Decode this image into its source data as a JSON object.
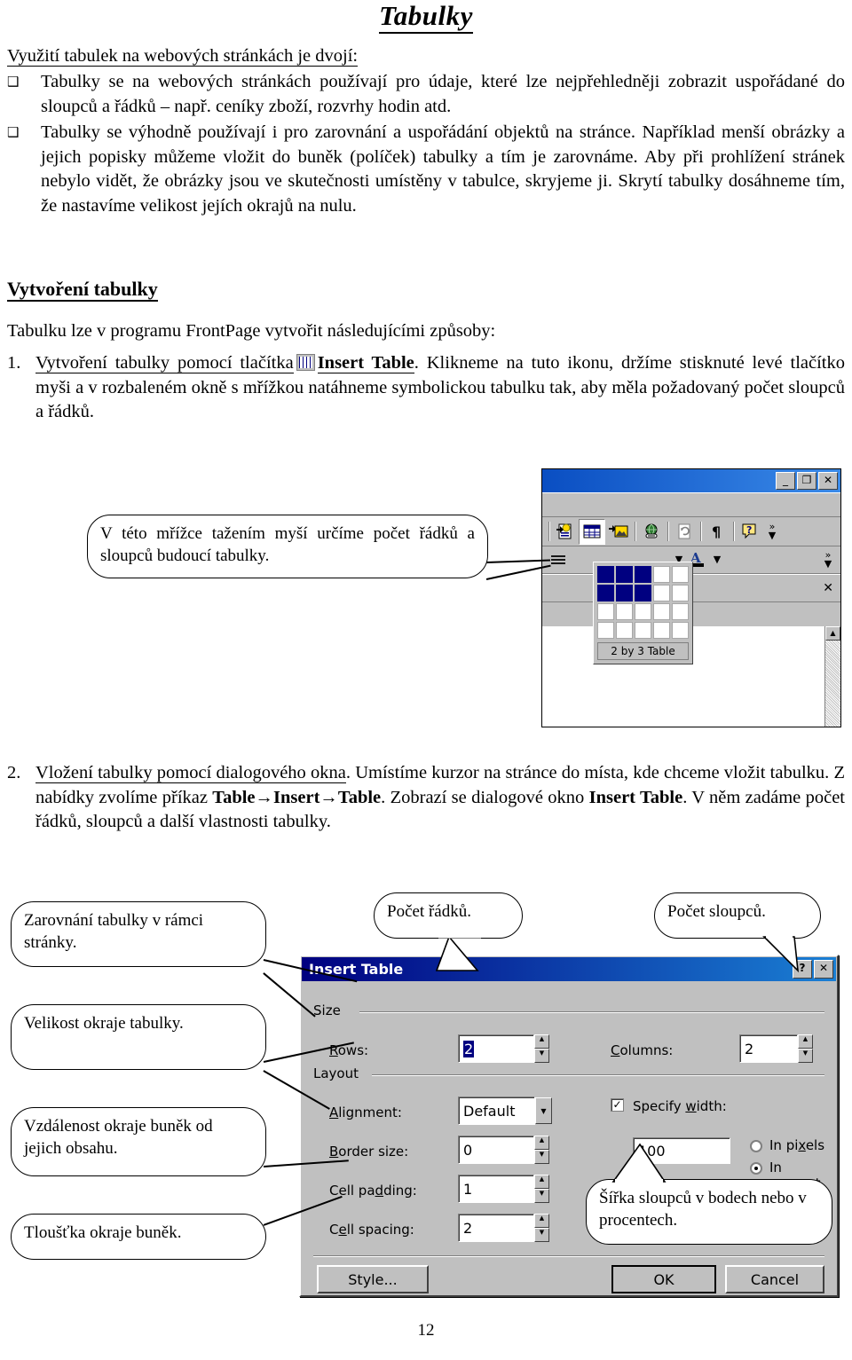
{
  "document": {
    "title": "Tabulky",
    "page_number": "12",
    "lead": "Využití tabulek na webových stránkách je dvojí:",
    "bullets": [
      "Tabulky se na webových stránkách používají pro údaje, které lze nejpřehledněji zobrazit uspořádané do  sloupců a řádků – např. ceníky zboží, rozvrhy hodin atd.",
      "Tabulky se výhodně používají i pro zarovnání a uspořádání objektů na stránce. Například menší obrázky a jejich popisky můžeme vložit do buněk (políček) tabulky a tím je zarovnáme. Aby při prohlížení stránek nebylo vidět, že obrázky jsou ve skutečnosti umístěny v tabulce, skryjeme ji. Skrytí tabulky dosáhneme tím, že nastavíme velikost jejích okrajů na nulu."
    ],
    "section_heading": "Vytvoření tabulky",
    "intro": "Tabulku lze v programu FrontPage vytvořit následujícími způsoby:",
    "item1": {
      "marker": "1.",
      "underlined_part": "Vytvoření tabulky pomocí tlačítka",
      "icon_name": "insert-table-icon",
      "bold_part": "Insert Table",
      "rest": ". Klikneme na tuto ikonu, držíme stisknuté levé tlačítko myši a v rozbaleném okně s mřížkou natáhneme symbolickou tabulku tak, aby měla požadovaný počet sloupců a řádků."
    },
    "item2": {
      "marker": "2.",
      "underlined_part": "Vložení tabulky pomocí dialogového okna",
      "mid": ". Umístíme kurzor na stránce do místa, kde chceme vložit tabulku. Z nabídky zvolíme příkaz ",
      "command": "Table→Insert→Table",
      "mid2": ". Zobrazí se dialogové okno ",
      "dialog_name": "Insert Table",
      "rest": ". V něm zadáme počet řádků, sloupců a další vlastnosti tabulky."
    }
  },
  "callouts": {
    "grid": "V této mřížce tažením myší určíme počet řádků a sloupců budoucí tabulky.",
    "rows": "Počet řádků.",
    "columns": "Počet sloupců.",
    "alignment": "Zarovnání tabulky v rámci stránky.",
    "border": "Velikost okraje tabulky.",
    "padding": "Vzdálenost okraje buněk od jejich obsahu.",
    "spacing": "Tloušťka okraje buněk.",
    "width": "Šířka sloupců v bodech nebo v procentech."
  },
  "frontpage_window": {
    "title": "",
    "window_controls": [
      {
        "name": "minimize",
        "glyph": "_"
      },
      {
        "name": "maximize",
        "glyph": "❐"
      },
      {
        "name": "close",
        "glyph": "✕"
      }
    ],
    "toolbar_icons": [
      "insert-component-icon",
      "insert-table-icon",
      "insert-image-icon",
      "insert-hyperlink-icon",
      "refresh-icon",
      "show-paragraph-marks-icon",
      "help-icon",
      "toolbar-overflow-icon"
    ],
    "toolbar2_icons": [
      "align-icon",
      "font-color-dropdown-icon",
      "highlight-color-icon",
      "toolbar-overflow-icon"
    ],
    "taskpane_close": "✕",
    "grid_dropdown": {
      "columns": 5,
      "rows": 4,
      "selected_rows": 2,
      "selected_cols": 3,
      "label": "2 by 3 Table",
      "selected_color": "#000080"
    }
  },
  "dialog": {
    "title": "Insert Table",
    "titlebar_buttons": [
      {
        "name": "help",
        "glyph": "?"
      },
      {
        "name": "close",
        "glyph": "✕"
      }
    ],
    "groups": {
      "size": "Size",
      "layout": "Layout"
    },
    "fields": {
      "rows": {
        "label": "Rows:",
        "value": "2",
        "selected": true
      },
      "columns": {
        "label": "Columns:",
        "value": "2"
      },
      "alignment": {
        "label": "Alignment:",
        "value": "Default"
      },
      "border_size": {
        "label": "Border size:",
        "value": "0"
      },
      "cell_padding": {
        "label": "Cell padding:",
        "value": "1"
      },
      "cell_spacing": {
        "label": "Cell spacing:",
        "value": "2"
      },
      "specify_width": {
        "label": "Specify width:",
        "checked": true,
        "value": "100"
      },
      "in_pixels": {
        "label": "In pixels",
        "selected": false
      },
      "in_percent": {
        "label": "In percent",
        "selected": true
      }
    },
    "buttons": {
      "style": "Style...",
      "ok": "OK",
      "cancel": "Cancel"
    }
  }
}
